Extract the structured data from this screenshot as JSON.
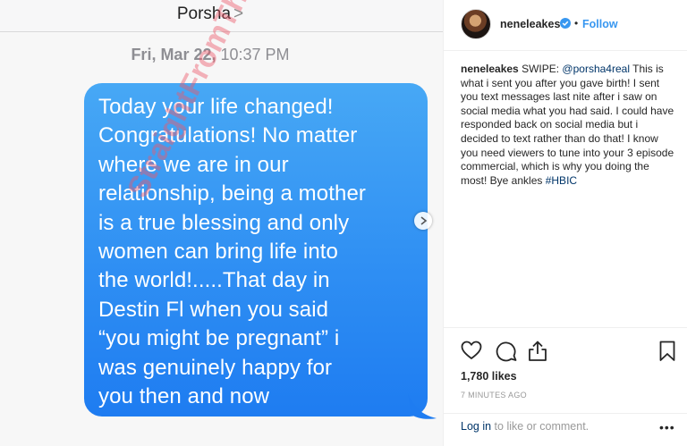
{
  "message_screenshot": {
    "contact_name": "Porsha",
    "contact_chevron": ">",
    "date_bold": "Fri, Mar 22,",
    "time": "10:37 PM",
    "bubble_lines": [
      "Today your life changed!",
      "Congratulations! No matter",
      "where we are in our",
      "relationship, being a mother",
      "is a true blessing and only",
      "women can bring life into",
      "the world!.....That day in",
      "Destin Fl when you said",
      "“you might be pregnant” i",
      "was genuinely happy for",
      "you then and now"
    ],
    "bubble_color": "#2f8ff3",
    "watermark": "StraightFromTheA"
  },
  "post": {
    "username": "neneleakes",
    "follow_label": "Follow",
    "follow_color": "#3897f0",
    "separator": "•",
    "verified_icon": "verified-badge-icon",
    "caption": {
      "username": "neneleakes",
      "lead": "SWIPE:",
      "mention": "@porsha4real",
      "body": "This is what i sent you after you gave birth! I sent you text messages last nite after i saw on social media what you had said. I could have responded back on social media but i decided to text rather than do that! I know you need viewers to tune into your 3 episode commercial, which is why you doing the most! Bye ankles",
      "hashtag": "#HBIC"
    },
    "icons": [
      "heart-icon",
      "comment-icon",
      "share-icon",
      "bookmark-icon"
    ],
    "likes": "1,780 likes",
    "timestamp": "7 MINUTES AGO",
    "login_link": "Log in",
    "login_rest": "to like or comment.",
    "more_label": "•••"
  }
}
